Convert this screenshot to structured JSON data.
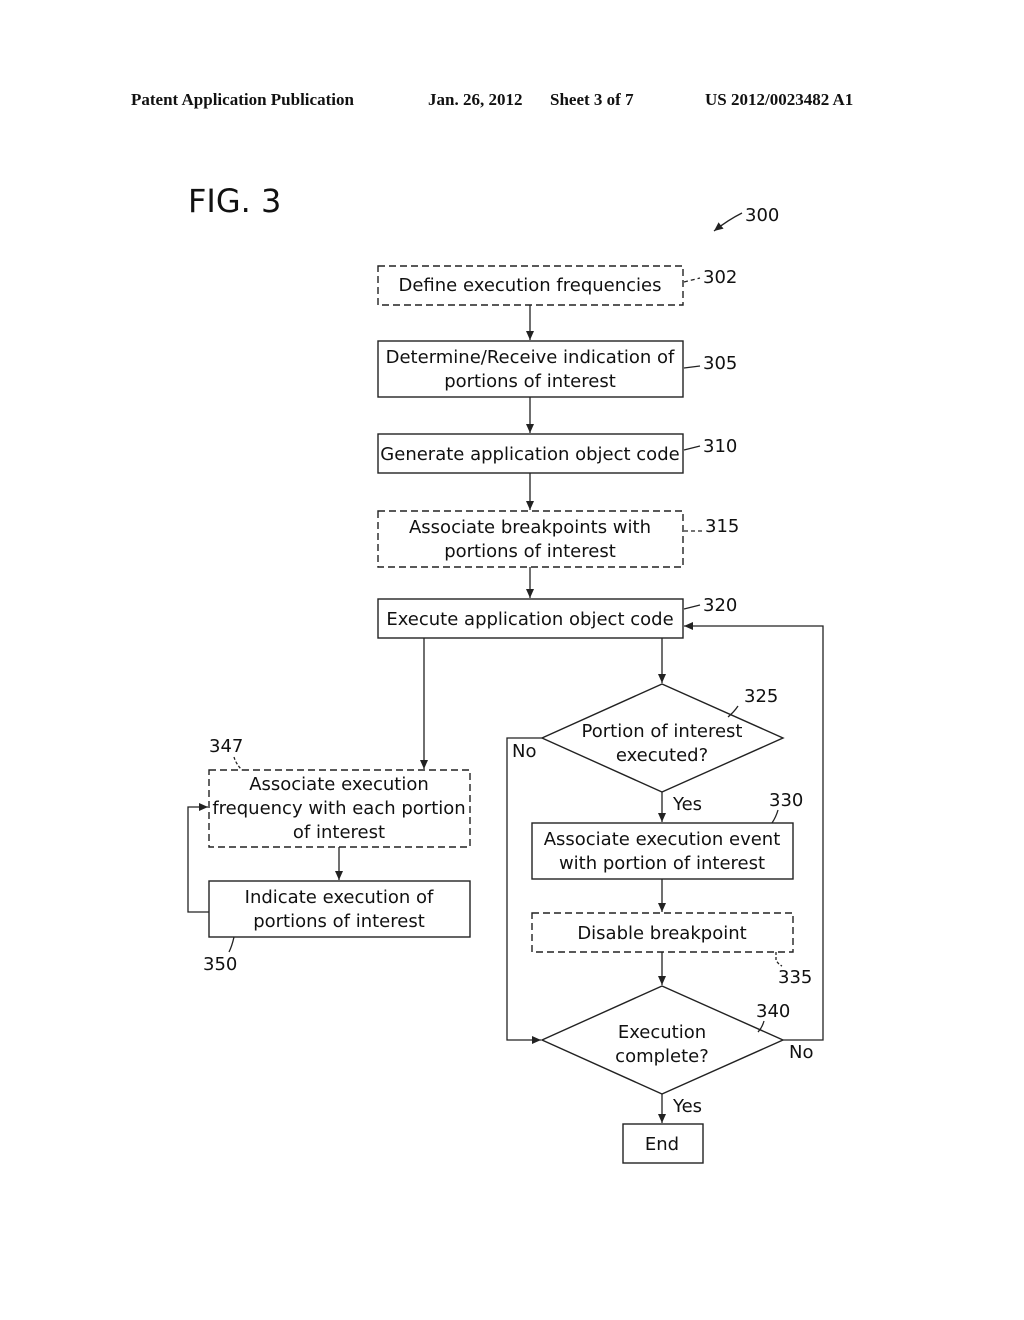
{
  "header": {
    "publication": "Patent Application Publication",
    "date": "Jan. 26, 2012",
    "sheet": "Sheet 3 of 7",
    "number": "US 2012/0023482 A1"
  },
  "figure": {
    "title": "FIG. 3",
    "ref": "300"
  },
  "steps": {
    "s302": {
      "ref": "302",
      "line1": "Define execution frequencies",
      "style": "dashed"
    },
    "s305": {
      "ref": "305",
      "line1": "Determine/Receive indication of",
      "line2": "portions of interest",
      "style": "solid"
    },
    "s310": {
      "ref": "310",
      "line1": "Generate application object code",
      "style": "solid"
    },
    "s315": {
      "ref": "315",
      "line1": "Associate breakpoints with",
      "line2": "portions of interest",
      "style": "dashed"
    },
    "s320": {
      "ref": "320",
      "line1": "Execute application object code",
      "style": "solid"
    },
    "s325": {
      "ref": "325",
      "line1": "Portion of interest",
      "line2": "executed?",
      "style": "decision"
    },
    "s330": {
      "ref": "330",
      "line1": "Associate execution event",
      "line2": "with portion of interest",
      "style": "solid"
    },
    "s335": {
      "ref": "335",
      "line1": "Disable breakpoint",
      "style": "dashed"
    },
    "s340": {
      "ref": "340",
      "line1": "Execution",
      "line2": "complete?",
      "style": "decision"
    },
    "s347": {
      "ref": "347",
      "line1": "Associate execution",
      "line2": "frequency with each portion",
      "line3": "of interest",
      "style": "dashed"
    },
    "s350": {
      "ref": "350",
      "line1": "Indicate execution of",
      "line2": "portions of interest",
      "style": "solid"
    },
    "end": {
      "line1": "End",
      "style": "solid"
    }
  },
  "branches": {
    "d325_no": "No",
    "d325_yes": "Yes",
    "d340_no": "No",
    "d340_yes": "Yes"
  }
}
